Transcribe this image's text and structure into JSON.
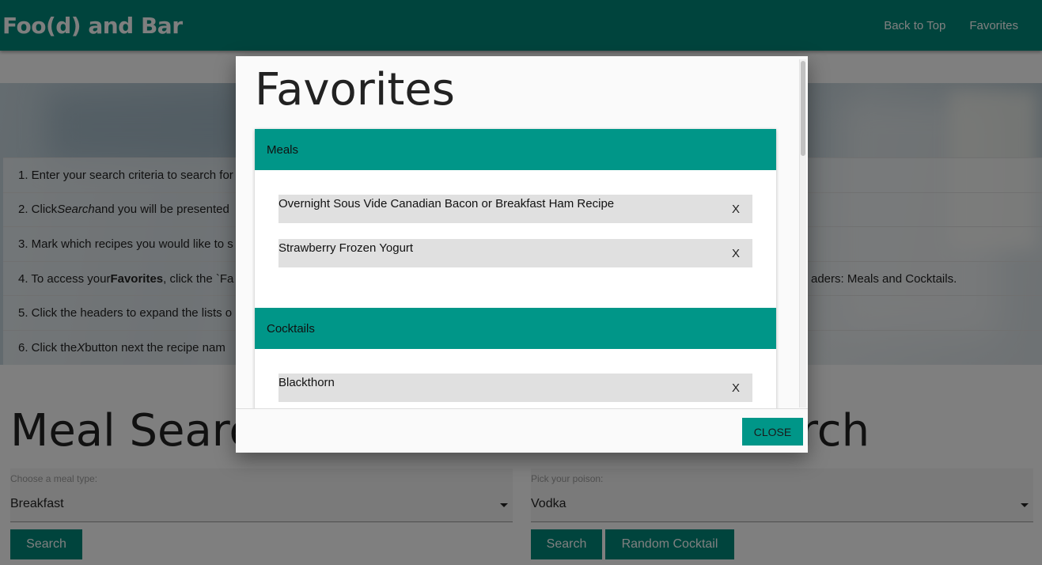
{
  "nav": {
    "brand": "Foo(d) and Bar",
    "links": [
      "Back to Top",
      "Favorites"
    ]
  },
  "steps": [
    {
      "pre": "1. Enter your search criteria to search for",
      "em": "",
      "post": ""
    },
    {
      "pre": "2. Click ",
      "em": "Search",
      "post": " and you will be presented"
    },
    {
      "pre": "3. Mark which recipes you would like to s",
      "em": "",
      "post": ""
    },
    {
      "pre": "4. To access your ",
      "bold": "Favorites",
      "post": ", click the `Fa",
      "tail": "aders: Meals and Cocktails."
    },
    {
      "pre": "5. Click the headers to expand the lists o",
      "em": "",
      "post": ""
    },
    {
      "pre": "6. Click the ",
      "em": "X",
      "post": " button next the recipe nam"
    }
  ],
  "meal_section": {
    "title": "Meal Searc",
    "select_label": "Choose a meal type:",
    "select_value": "Breakfast",
    "search_label": "Search"
  },
  "cocktail_section": {
    "title": "rch",
    "select_label": "Pick your poison:",
    "select_value": "Vodka",
    "search_label": "Search",
    "random_label": "Random Cocktail"
  },
  "modal": {
    "title": "Favorites",
    "close_label": "CLOSE",
    "meals_header": "Meals",
    "meals": [
      "Overnight Sous Vide Canadian Bacon or Breakfast Ham Recipe",
      "Strawberry Frozen Yogurt"
    ],
    "cocktails_header": "Cocktails",
    "cocktails": [
      "Blackthorn"
    ],
    "remove_label": "X"
  },
  "colors": {
    "primary": "#00897b",
    "accent": "#009688"
  }
}
